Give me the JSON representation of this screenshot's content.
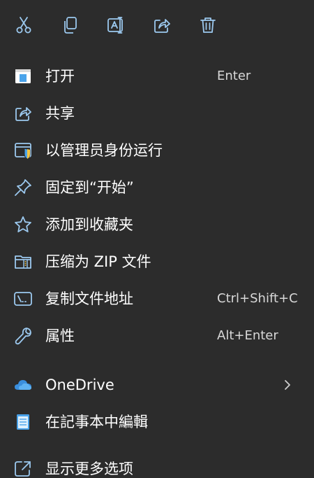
{
  "toolbar": {
    "items": [
      {
        "icon": "scissors-icon",
        "action": "cut"
      },
      {
        "icon": "copy-icon",
        "action": "copy"
      },
      {
        "icon": "rename-icon",
        "action": "rename"
      },
      {
        "icon": "share-icon",
        "action": "share"
      },
      {
        "icon": "trash-icon",
        "action": "delete"
      }
    ]
  },
  "menu": {
    "open": {
      "label": "打开",
      "shortcut": "Enter",
      "icon": "window-icon"
    },
    "share": {
      "label": "共享",
      "icon": "share-icon"
    },
    "run_as_admin": {
      "label": "以管理员身份运行",
      "icon": "shield-icon"
    },
    "pin_start": {
      "label": "固定到“开始”",
      "icon": "pin-icon"
    },
    "add_favorites": {
      "label": "添加到收藏夹",
      "icon": "star-icon"
    },
    "compress_zip": {
      "label": "压缩为 ZIP 文件",
      "icon": "zip-folder-icon"
    },
    "copy_path": {
      "label": "复制文件地址",
      "shortcut": "Ctrl+Shift+C",
      "icon": "path-icon"
    },
    "properties": {
      "label": "属性",
      "shortcut": "Alt+Enter",
      "icon": "wrench-icon"
    },
    "onedrive": {
      "label": "OneDrive",
      "icon": "cloud-icon"
    },
    "notepad": {
      "label": "在記事本中編輯",
      "icon": "notepad-icon"
    },
    "more_options": {
      "label": "显示更多选项",
      "icon": "expand-icon"
    }
  },
  "colors": {
    "background": "#2c2c2c",
    "icon_stroke": "#9cc9ef",
    "text": "#ffffff",
    "shortcut_text": "#d8d8d8",
    "accent_blue": "#4aa3ea",
    "onedrive_blue": "#3a8fde"
  }
}
